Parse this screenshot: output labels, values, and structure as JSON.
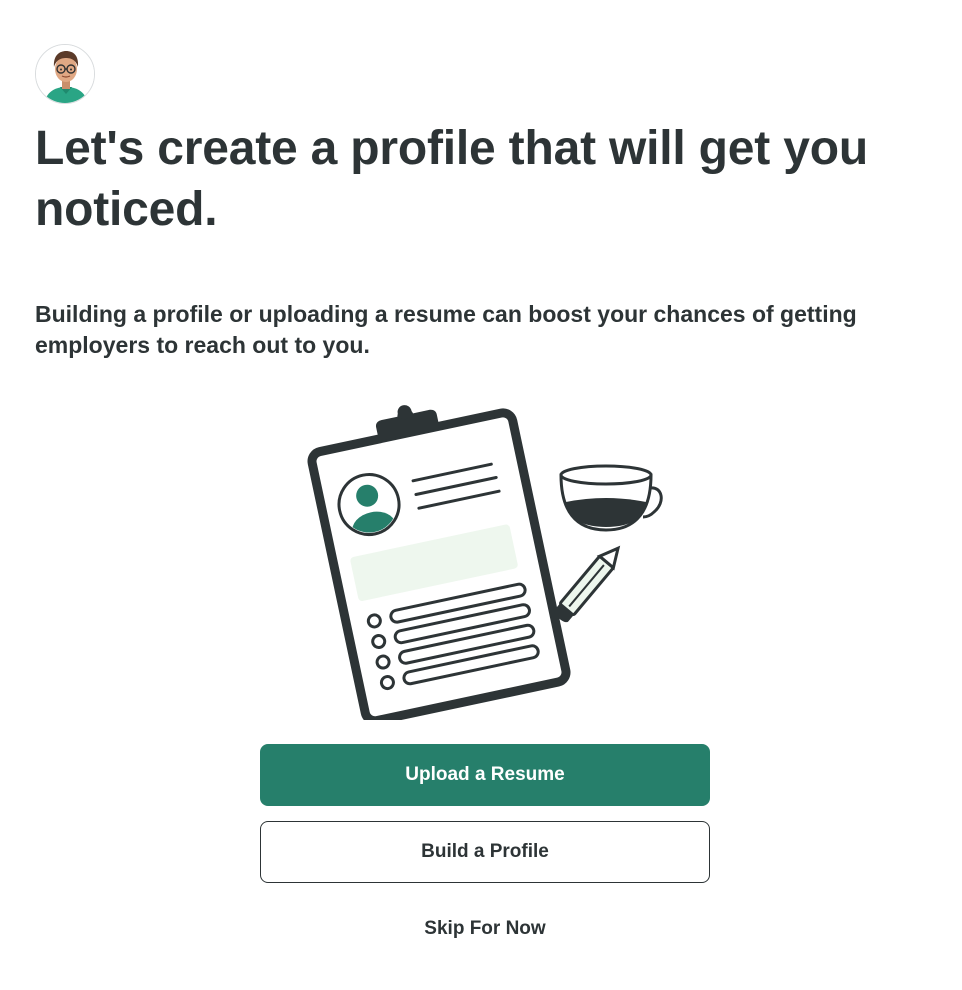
{
  "header": {
    "avatar_icon": "user-avatar-icon"
  },
  "main": {
    "headline": "Let's create a profile that will get you noticed.",
    "subtext": "Building a profile or uploading a resume can boost your chances of getting employers to reach out to you.",
    "illustration_icon": "resume-clipboard-illustration"
  },
  "actions": {
    "upload_resume_label": "Upload a Resume",
    "build_profile_label": "Build a Profile",
    "skip_label": "Skip For Now"
  },
  "colors": {
    "primary": "#267f6b",
    "text": "#2d3436",
    "accent_light": "#eef7ee"
  }
}
